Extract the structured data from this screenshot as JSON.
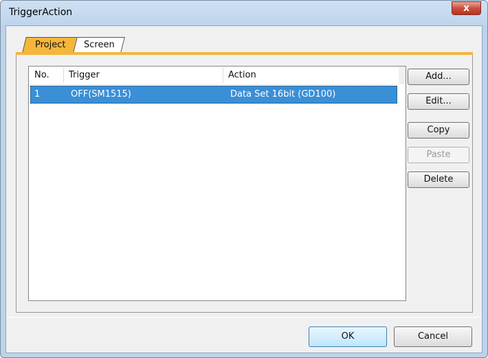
{
  "window": {
    "title": "TriggerAction",
    "close_glyph": "x"
  },
  "tabs": [
    {
      "label": "Project",
      "active": true
    },
    {
      "label": "Screen",
      "active": false
    }
  ],
  "list": {
    "columns": [
      "No.",
      "Trigger",
      "Action"
    ],
    "rows": [
      {
        "no": "1",
        "trigger": "OFF(SM1515)",
        "action": "Data Set 16bit (GD100)",
        "selected": true
      }
    ]
  },
  "side_buttons": {
    "add": {
      "label": "Add...",
      "enabled": true
    },
    "edit": {
      "label": "Edit...",
      "enabled": true
    },
    "copy": {
      "label": "Copy",
      "enabled": true
    },
    "paste": {
      "label": "Paste",
      "enabled": false
    },
    "delete": {
      "label": "Delete",
      "enabled": true
    }
  },
  "footer": {
    "ok": "OK",
    "cancel": "Cancel"
  },
  "colors": {
    "tab_active": "#f5b63c",
    "selection": "#3a8fd6",
    "title_bg": "#bcd3ec"
  }
}
